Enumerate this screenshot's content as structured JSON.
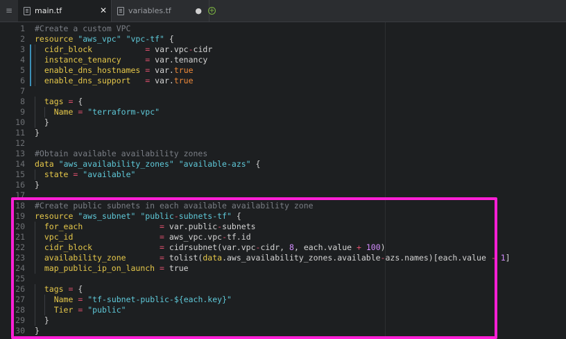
{
  "tabs": {
    "menu_icon": "hamburger-menu-icon",
    "active": {
      "label": "main.tf",
      "close_glyph": "✕",
      "icon": "file-icon"
    },
    "inactive": {
      "label": "variables.tf",
      "modified_glyph": "●",
      "icon": "file-icon"
    },
    "add_glyph": "+"
  },
  "lines": [
    {
      "n": "1",
      "text": "#Create a custom VPC"
    },
    {
      "n": "2",
      "text": "resource \"aws_vpc\" \"vpc-tf\" {"
    },
    {
      "n": "3",
      "text": "  cidr_block           = var.vpc-cidr"
    },
    {
      "n": "4",
      "text": "  instance_tenancy     = var.tenancy"
    },
    {
      "n": "5",
      "text": "  enable_dns_hostnames = var.true"
    },
    {
      "n": "6",
      "text": "  enable_dns_support   = var.true"
    },
    {
      "n": "7",
      "text": ""
    },
    {
      "n": "8",
      "text": "  tags = {"
    },
    {
      "n": "9",
      "text": "    Name = \"terraform-vpc\""
    },
    {
      "n": "10",
      "text": "  }"
    },
    {
      "n": "11",
      "text": "}"
    },
    {
      "n": "12",
      "text": ""
    },
    {
      "n": "13",
      "text": "#Obtain available availability zones"
    },
    {
      "n": "14",
      "text": "data \"aws_availability_zones\" \"available-azs\" {"
    },
    {
      "n": "15",
      "text": "  state = \"available\""
    },
    {
      "n": "16",
      "text": "}"
    },
    {
      "n": "17",
      "text": ""
    },
    {
      "n": "18",
      "text": "#Create public subnets in each available availability zone"
    },
    {
      "n": "19",
      "text": "resource \"aws_subnet\" \"public-subnets-tf\" {"
    },
    {
      "n": "20",
      "text": "  for_each                = var.public-subnets"
    },
    {
      "n": "21",
      "text": "  vpc_id                  = aws_vpc.vpc-tf.id"
    },
    {
      "n": "22",
      "text": "  cidr_block              = cidrsubnet(var.vpc-cidr, 8, each.value + 100)"
    },
    {
      "n": "23",
      "text": "  availability_zone       = tolist(data.aws_availability_zones.available-azs.names)[each.value - 1]"
    },
    {
      "n": "24",
      "text": "  map_public_ip_on_launch = true"
    },
    {
      "n": "25",
      "text": ""
    },
    {
      "n": "26",
      "text": "  tags = {"
    },
    {
      "n": "27",
      "text": "    Name = \"tf-subnet-public-${each.key}\""
    },
    {
      "n": "28",
      "text": "    Tier = \"public\""
    },
    {
      "n": "29",
      "text": "  }"
    },
    {
      "n": "30",
      "text": "}"
    }
  ],
  "colors": {
    "highlight_box": "#ff1fd6",
    "keyword": "#e6c84a",
    "string": "#5fc9d9",
    "operator": "#e0506e",
    "number": "#d38cff",
    "comment": "#7a7e85"
  }
}
